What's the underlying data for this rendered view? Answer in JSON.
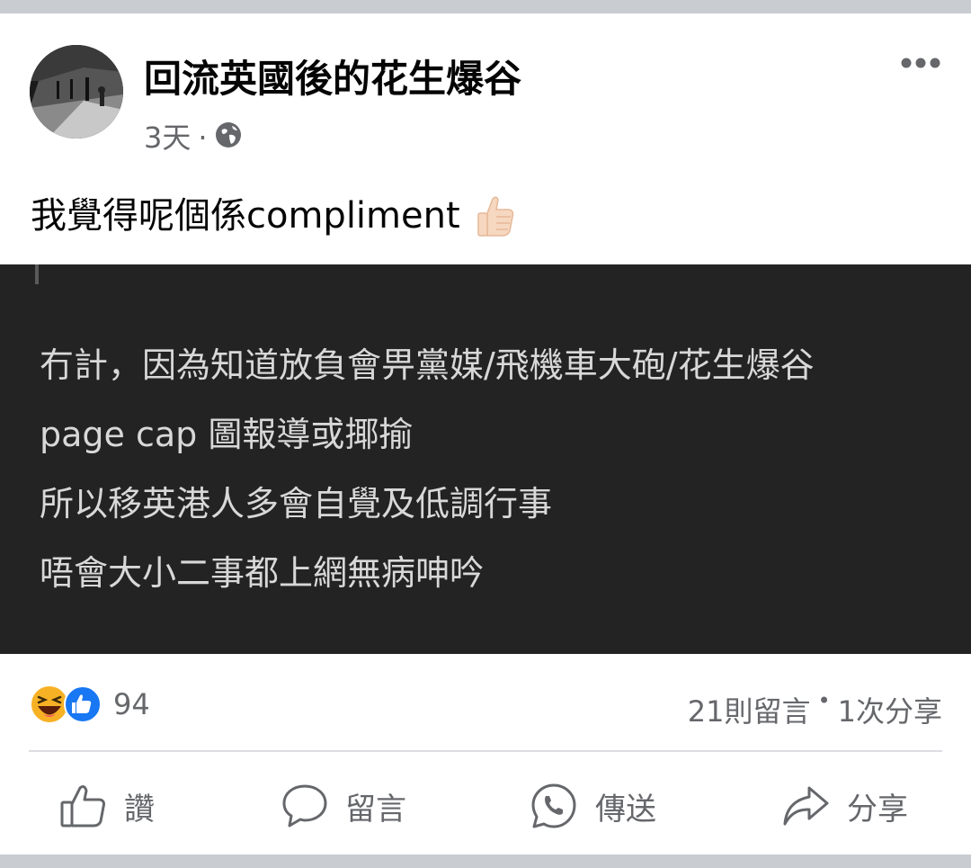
{
  "post": {
    "page_name": "回流英國後的花生爆谷",
    "time": "3天",
    "separator": "·",
    "privacy_icon": "globe-icon",
    "text": "我覺得呢個係compliment",
    "emoji": "thumbs-up-icon"
  },
  "image_text": {
    "line1": "冇計，因為知道放負會畀黨媒/飛機車大砲/花生爆谷",
    "line2": "page cap 圖報導或揶揄",
    "line3": "所以移英港人多會自覺及低調行事",
    "line4": "唔會大小二事都上網無病呻吟"
  },
  "reactions": {
    "icons": [
      "haha-icon",
      "like-icon"
    ],
    "count": "94"
  },
  "stats": {
    "comments": "21則留言",
    "separator": "•",
    "shares": "1次分享"
  },
  "actions": {
    "like": "讚",
    "comment": "留言",
    "send": "傳送",
    "share": "分享"
  },
  "colors": {
    "like_blue": "#1877f2",
    "haha_yellow": "#f7b125",
    "text_gray": "#65676b"
  }
}
